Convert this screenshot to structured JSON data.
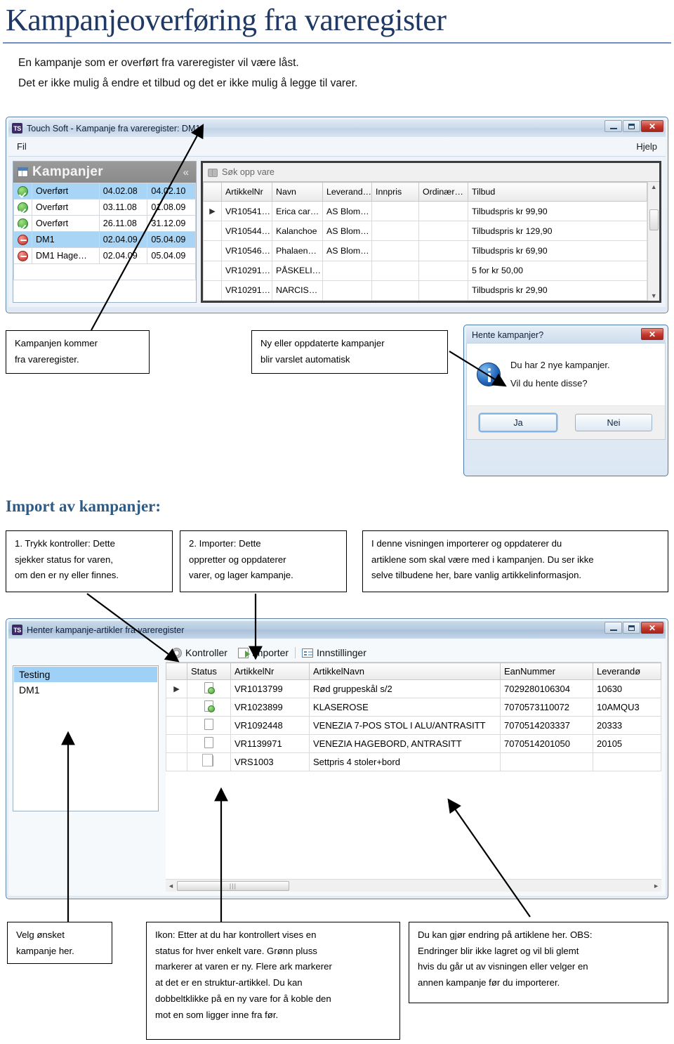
{
  "document": {
    "title": "Kampanjeoverføring fra vareregister",
    "intro_line_1": "En kampanje som er overført fra vareregister vil være låst.",
    "intro_line_2": "Det er ikke mulig å endre et tilbud og det er ikke mulig å legge til varer.",
    "section_heading": "Import av kampanjer:",
    "accent_color": "#1F3864",
    "rule_color": "#6f8fc0",
    "section_color": "#2E5A86"
  },
  "window1": {
    "logo_text": "TS",
    "title": "Touch Soft - Kampanje fra vareregister: DM1",
    "menu_left": "Fil",
    "menu_right": "Hjelp",
    "buttons": {
      "minimize": "—",
      "maximize": "□",
      "close": "✕"
    },
    "campaign_panel": {
      "heading": "Kampanjer",
      "collapse_label": "«",
      "rows": [
        {
          "status": "ok",
          "name": "Overført",
          "from": "04.02.08",
          "to": "04.02.10",
          "selected": false
        },
        {
          "status": "ok",
          "name": "Overført",
          "from": "03.11.08",
          "to": "01.08.09",
          "selected": false
        },
        {
          "status": "ok",
          "name": "Overført",
          "from": "26.11.08",
          "to": "31.12.09",
          "selected": false
        },
        {
          "status": "no",
          "name": "DM1",
          "from": "02.04.09",
          "to": "05.04.09",
          "selected": true
        },
        {
          "status": "no",
          "name": "DM1 Hage…",
          "from": "02.04.09",
          "to": "05.04.09",
          "selected": false
        }
      ]
    },
    "search_panel": {
      "toolbar_label": "Søk opp vare",
      "columns": [
        "",
        "ArtikkelNr",
        "Navn",
        "Leverand…",
        "Innpris",
        "Ordinær…",
        "Tilbud"
      ],
      "rows": [
        {
          "marker": "▶",
          "artikkelnr": "VR10541…",
          "navn": "Erica car…",
          "leverandor": "AS Blom…",
          "innpris": "",
          "ordinaer": "",
          "tilbud": "Tilbudspris kr 99,90",
          "selected": true
        },
        {
          "marker": "",
          "artikkelnr": "VR10544…",
          "navn": "Kalanchoe",
          "leverandor": "AS Blom…",
          "innpris": "",
          "ordinaer": "",
          "tilbud": "Tilbudspris kr 129,90",
          "selected": false
        },
        {
          "marker": "",
          "artikkelnr": "VR10546…",
          "navn": "Phalaen…",
          "leverandor": "AS Blom…",
          "innpris": "",
          "ordinaer": "",
          "tilbud": "Tilbudspris kr 69,90",
          "selected": false
        },
        {
          "marker": "",
          "artikkelnr": "VR10291…",
          "navn": "PÅSKELI…",
          "leverandor": "",
          "innpris": "",
          "ordinaer": "",
          "tilbud": "5 for kr 50,00",
          "selected": false
        },
        {
          "marker": "",
          "artikkelnr": "VR10291…",
          "navn": "NARCIS…",
          "leverandor": "",
          "innpris": "",
          "ordinaer": "",
          "tilbud": "Tilbudspris kr 29,90",
          "selected": false
        }
      ],
      "scroll_up": "▲",
      "scroll_down": "▼"
    }
  },
  "dialog": {
    "title": "Hente kampanjer?",
    "close_label": "✕",
    "message_line_1": "Du har 2 nye kampanjer.",
    "message_line_2": "Vil du hente disse?",
    "yes_label": "Ja",
    "no_label": "Nei"
  },
  "callouts": {
    "c1_line1": "Kampanjen kommer",
    "c1_line2": "fra vareregister.",
    "c2_line1": "Ny eller oppdaterte kampanjer",
    "c2_line2": "blir varslet automatisk",
    "step1_line1": "1. Trykk kontroller: Dette",
    "step1_line2": "sjekker status for varen,",
    "step1_line3": "om den er ny eller finnes.",
    "step2_line1": "2. Importer: Dette",
    "step2_line2": "oppretter og oppdaterer",
    "step2_line3": "varer, og lager kampanje.",
    "step3_line1": "I denne visningen importerer og oppdaterer du",
    "step3_line2": "artiklene som skal være med i kampanjen. Du ser ikke",
    "step3_line3": "selve tilbudene her, bare vanlig artikkelinformasjon.",
    "b1_line1": "Velg ønsket",
    "b1_line2": "kampanje her.",
    "b2_line1": "Ikon: Etter at du har kontrollert vises en",
    "b2_line2": "status for hver enkelt vare. Grønn pluss",
    "b2_line3": "markerer at varen er ny. Flere ark markerer",
    "b2_line4": "at det er en struktur-artikkel. Du kan",
    "b2_line5": "dobbeltklikke på en ny vare for å koble den",
    "b2_line6": "mot en som ligger inne fra før.",
    "b3_line1": "Du kan gjør endring på artiklene her. OBS:",
    "b3_line2": "Endringer blir ikke lagret og vil bli glemt",
    "b3_line3": "hvis du går ut av visningen eller velger en",
    "b3_line4": "annen kampanje før du importerer."
  },
  "window2": {
    "logo_text": "TS",
    "title": "Henter kampanje-artikler fra vareregister",
    "buttons": {
      "minimize": "—",
      "maximize": "□",
      "close": "✕"
    },
    "campaign_list": [
      {
        "label": "Testing",
        "selected": true
      },
      {
        "label": "DM1",
        "selected": false
      }
    ],
    "toolbar": [
      {
        "icon": "gear-icon",
        "label": "Kontroller"
      },
      {
        "icon": "import-icon",
        "label": "Importer"
      },
      {
        "icon": "settings-icon",
        "label": "Innstillinger"
      }
    ],
    "columns": [
      "",
      "Status",
      "ArtikkelNr",
      "ArtikkelNavn",
      "EanNummer",
      "Leverandø"
    ],
    "rows": [
      {
        "marker": "▶",
        "status_icon": "doc-new",
        "artikkelnr": "VR1013799",
        "artikkelnavn": "Rød gruppeskål s/2",
        "ean": "7029280106304",
        "leverandor": "10630",
        "selected": true
      },
      {
        "marker": "",
        "status_icon": "doc-new",
        "artikkelnr": "VR1023899",
        "artikkelnavn": "KLASEROSE",
        "ean": "7070573110072",
        "leverandor": "10AMQU3",
        "selected": false
      },
      {
        "marker": "",
        "status_icon": "doc-plain",
        "artikkelnr": "VR1092448",
        "artikkelnavn": "VENEZIA 7-POS STOL I ALU/ANTRASITT",
        "ean": "7070514203337",
        "leverandor": "20333",
        "selected": false
      },
      {
        "marker": "",
        "status_icon": "doc-plain",
        "artikkelnr": "VR1139971",
        "artikkelnavn": "VENEZIA HAGEBORD, ANTRASITT",
        "ean": "7070514201050",
        "leverandor": "20105",
        "selected": false
      },
      {
        "marker": "",
        "status_icon": "doc-multi",
        "artikkelnr": "VRS1003",
        "artikkelnavn": "Settpris 4 stoler+bord",
        "ean": "",
        "leverandor": "",
        "selected": false
      }
    ],
    "hscroll": {
      "left": "◄",
      "right": "►",
      "grip": "|||"
    }
  }
}
